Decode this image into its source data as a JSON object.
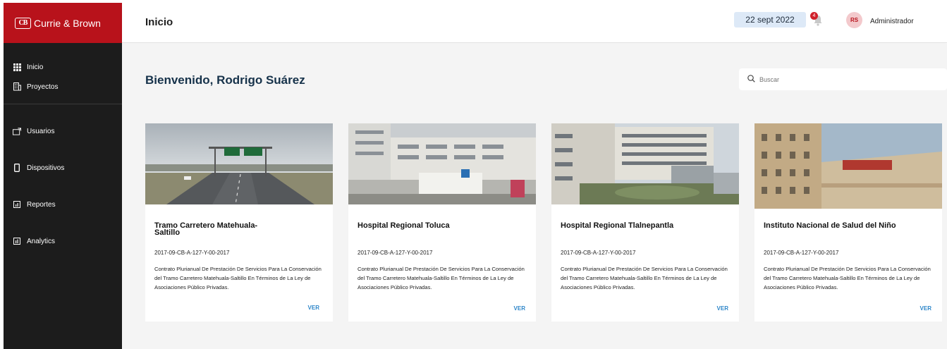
{
  "brand": {
    "name": "Currie & Brown",
    "mark": "CB",
    "color": "#b8121b"
  },
  "sidebar": {
    "items": [
      {
        "label": "Inicio",
        "icon": "grid-icon"
      },
      {
        "label": "Proyectos",
        "icon": "building-icon"
      },
      {
        "label": "Usuarios",
        "icon": "users-icon"
      },
      {
        "label": "Dispositivos",
        "icon": "phone-icon"
      },
      {
        "label": "Reportes",
        "icon": "report-icon"
      },
      {
        "label": "Analytics",
        "icon": "analytics-icon"
      }
    ]
  },
  "header": {
    "title": "Inicio",
    "date": "22 sept 2022",
    "notifications": "4",
    "avatar_initials": "RS",
    "user_name": "Administrador"
  },
  "main": {
    "welcome": "Bienvenido, Rodrigo Suárez",
    "search_placeholder": "Buscar"
  },
  "projects": [
    {
      "title": "Tramo Carretero Matehuala-Saltillo",
      "code": "2017-09-CB-A-127-Y-00-2017",
      "description": "Contrato Plurianual De Prestación De Servicios Para La Conservación del Tramo Carretero Matehuala-Saltillo En Términos de La Ley de Asociaciones Público Privadas.",
      "button": "VER",
      "image": "highway-photo"
    },
    {
      "title": "Hospital Regional Toluca",
      "code": "2017-09-CB-A-127-Y-00-2017",
      "description": "Contrato Plurianual De Prestación De Servicios Para La Conservación del Tramo Carretero Matehuala-Saltillo En Términos de La Ley de Asociaciones Público Privadas.",
      "button": "VER",
      "image": "hospital-toluca-photo"
    },
    {
      "title": "Hospital Regional Tlalnepantla",
      "code": "2017-09-CB-A-127-Y-00-2017",
      "description": "Contrato Plurianual De Prestación De Servicios Para La Conservación del Tramo Carretero Matehuala-Saltillo En Términos de La Ley de Asociaciones Público Privadas.",
      "button": "VER",
      "image": "hospital-tlalnepantla-photo"
    },
    {
      "title": "Instituto Nacional de Salud del Niño",
      "code": "2017-09-CB-A-127-Y-00-2017",
      "description": "Contrato Plurianual De Prestación De Servicios Para La Conservación del Tramo Carretero Matehuala-Saltillo En Términos de La Ley de Asociaciones Público Privadas.",
      "button": "VER",
      "image": "instituto-nino-photo"
    }
  ],
  "colors": {
    "sidebar_bg": "#1c1c1c",
    "brand_red": "#b8121b",
    "link_blue": "#2d86c9",
    "date_pill": "#dde9f7"
  }
}
